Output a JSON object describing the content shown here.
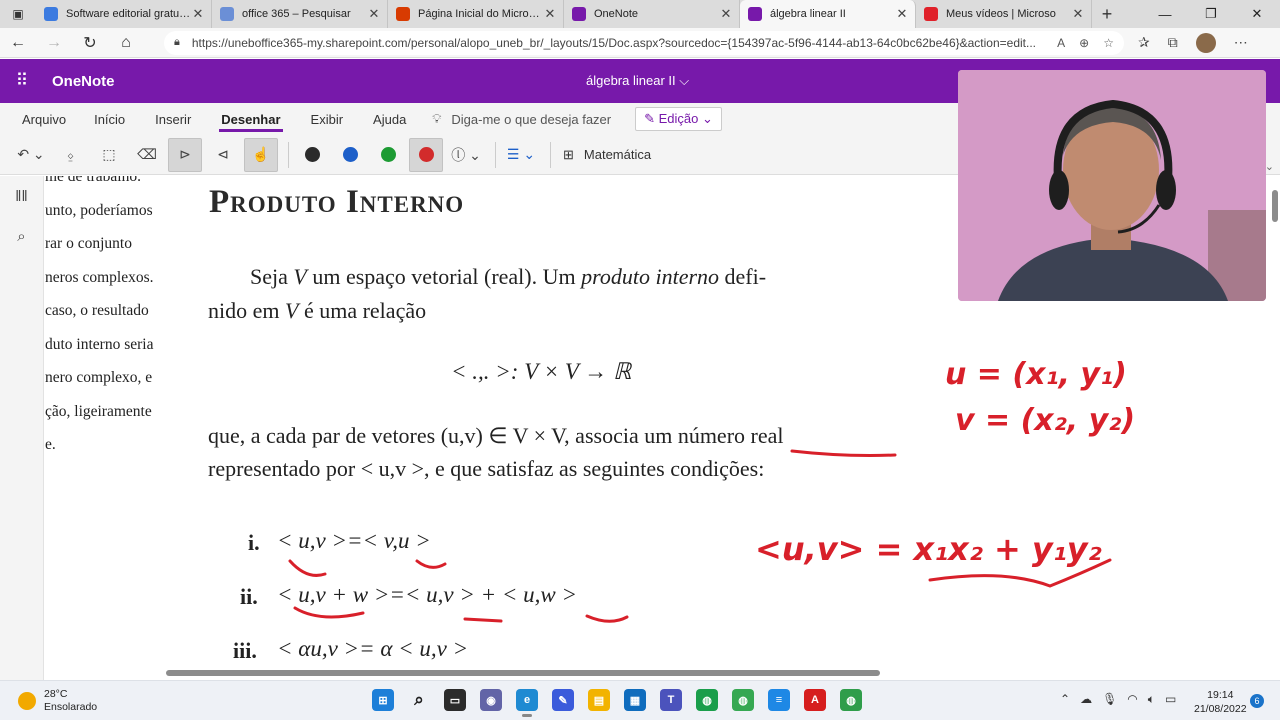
{
  "browser": {
    "tabs": [
      {
        "label": "Software editorial gratuito |",
        "favicon_color": "#3c7be0",
        "favicon": "grid-favicon-icon"
      },
      {
        "label": "office 365 – Pesquisar",
        "favicon_color": "#6b8fd6",
        "favicon": "search-favicon-icon"
      },
      {
        "label": "Página Inicial do Microsoft",
        "favicon_color": "#d83b01",
        "favicon": "office-favicon-icon"
      },
      {
        "label": "OneNote",
        "favicon_color": "#7719aa",
        "favicon": "onenote-favicon-icon"
      },
      {
        "label": "álgebra linear II",
        "favicon_color": "#7719aa",
        "favicon": "onenote-favicon-icon"
      },
      {
        "label": "Meus vídeos | Microso",
        "favicon_color": "#e0212a",
        "favicon": "stream-favicon-icon"
      }
    ],
    "url": "https://uneboffice365-my.sharepoint.com/personal/alopo_uneb_br/_layouts/15/Doc.aspx?sourcedoc={154397ac-5f96-4144-ab13-64c0bc62be46}&action=edit..."
  },
  "app": {
    "name": "OneNote",
    "doc_title": "álgebra linear II ⌵",
    "accent": "#7719aa"
  },
  "ribbon": {
    "menu": [
      "Arquivo",
      "Início",
      "Inserir",
      "Desenhar",
      "Exibir",
      "Ajuda"
    ],
    "selected_menu": "Desenhar",
    "tell_me": "Diga-me o que deseja fazer",
    "edit_mode": "Edição",
    "math_label": "Matemática",
    "pen_colors": [
      "#2b2b2b",
      "#1d5fc9",
      "#1d9b33",
      "#d22b2b"
    ]
  },
  "page": {
    "side_lines": [
      "me de trabalho.",
      "unto, poderíamos",
      "rar o conjunto",
      "neros complexos.",
      "caso, o resultado",
      "duto interno seria",
      "nero complexo, e",
      "ção, ligeiramente",
      "e."
    ],
    "heading": "Produto Interno",
    "para1_line1_a": "Seja ",
    "para1_line1_V": "V",
    "para1_line1_b": " um espaço vetorial (real).  Um ",
    "para1_line1_em": "produto interno",
    "para1_line1_c": " defi-",
    "para1_line2_a": "nido em ",
    "para1_line2_V": "V",
    "para1_line2_b": " é uma relação",
    "map_formula": "< .,. >: V × V → ℝ",
    "para2_line1": "que, a cada par de vetores (u,v) ∈ V × V, associa um número real",
    "para2_line2": "representado por < u,v >, e que satisfaz as seguintes condições:",
    "conditions": [
      {
        "num": "i.",
        "expr": "< u,v >=< v,u >"
      },
      {
        "num": "ii.",
        "expr": "< u,v + w >=< u,v > + < u,w >"
      },
      {
        "num": "iii.",
        "expr": "< αu,v >= α < u,v >"
      }
    ]
  },
  "handwriting": {
    "u_def": "u = (x₁, y₁)",
    "v_def": "v = (x₂, y₂)",
    "inner_product": "<u,v> = x₁x₂ + y₁y₂",
    "ink_color": "#d8202a"
  },
  "taskbar": {
    "temperature": "28°C",
    "weather": "Ensolarado",
    "time": "19:14",
    "date": "21/08/2022",
    "notifications": "6"
  }
}
